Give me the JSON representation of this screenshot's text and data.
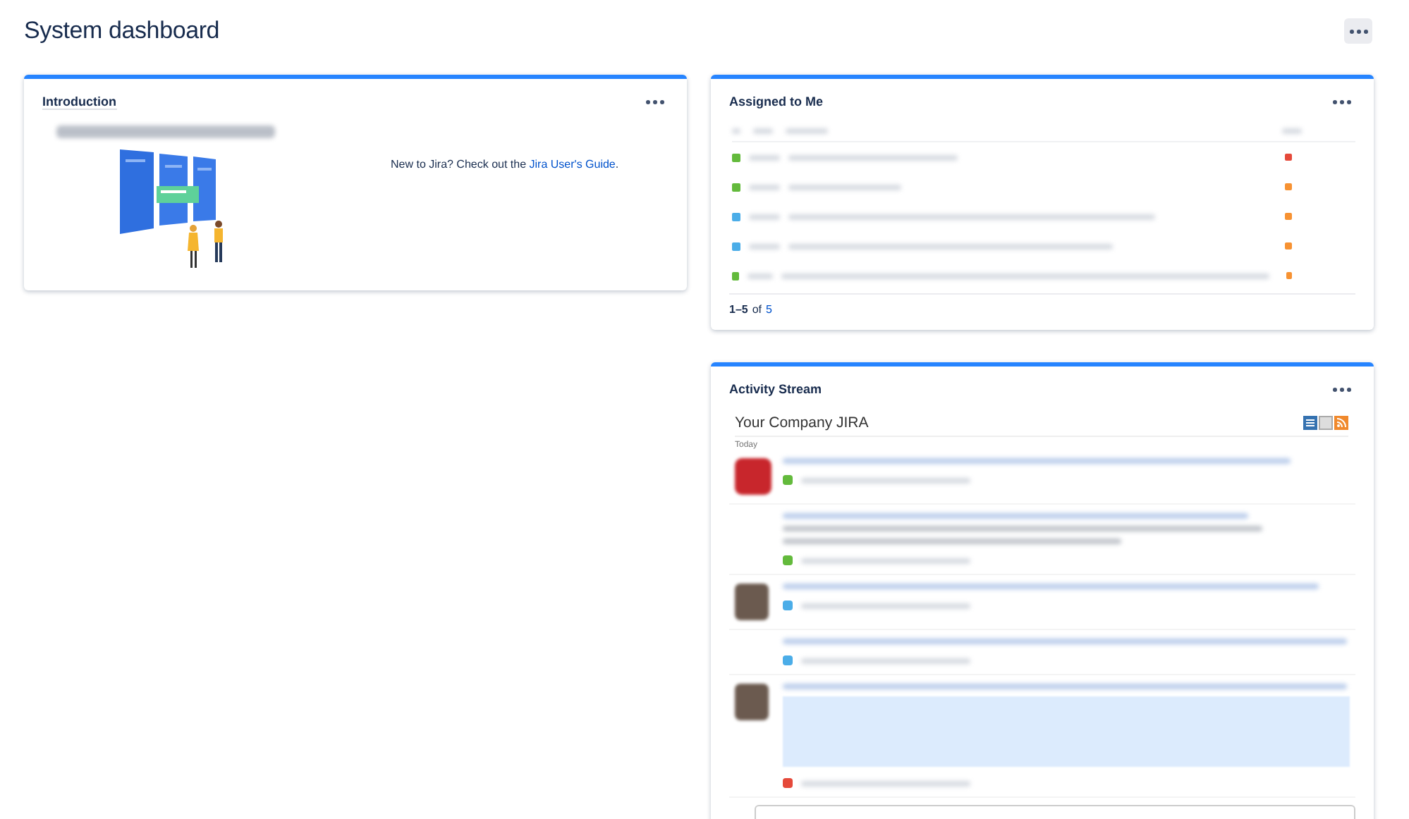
{
  "page": {
    "title": "System dashboard"
  },
  "intro": {
    "title": "Introduction",
    "text": "New to Jira? Check out the ",
    "link": "Jira User's Guide",
    "suffix": "."
  },
  "assigned": {
    "title": "Assigned to Me",
    "rows": [
      {
        "type_icon": {
          "color": "#63ba3c"
        },
        "priority_icon": {
          "color": "#e5493a"
        }
      },
      {
        "type_icon": {
          "color": "#63ba3c"
        },
        "priority_icon": {
          "color": "#f79232"
        }
      },
      {
        "type_icon": {
          "color": "#4bade8"
        },
        "priority_icon": {
          "color": "#f79232"
        }
      },
      {
        "type_icon": {
          "color": "#4bade8"
        },
        "priority_icon": {
          "color": "#f79232"
        }
      },
      {
        "type_icon": {
          "color": "#63ba3c"
        },
        "priority_icon": {
          "color": "#f79232"
        }
      }
    ],
    "range": "1–5",
    "of": "of",
    "total": "5"
  },
  "activity": {
    "title": "Activity Stream",
    "feed_title": "Your Company JIRA",
    "day": "Today",
    "entries": [
      {
        "kind": "app",
        "color": "#63ba3c"
      },
      {
        "kind": "described",
        "color": "#63ba3c"
      },
      {
        "kind": "photo",
        "color": "#4bade8"
      },
      {
        "kind": "plain",
        "color": "#4bade8"
      },
      {
        "kind": "commented",
        "color": "#e5493a"
      }
    ]
  }
}
